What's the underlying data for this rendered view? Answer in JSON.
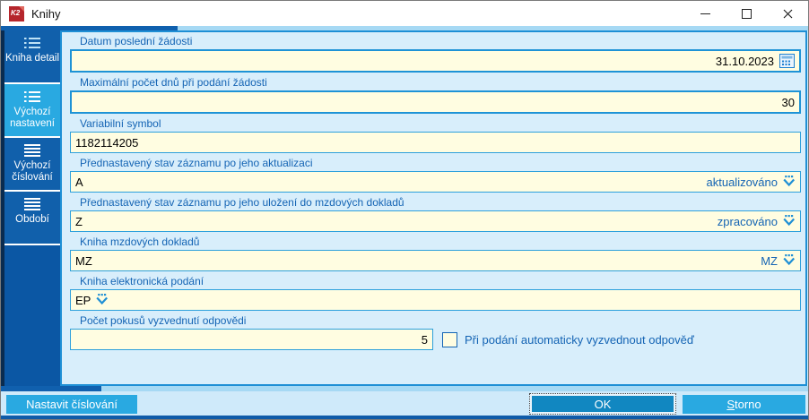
{
  "window": {
    "title": "Knihy"
  },
  "sidebar": {
    "items": [
      {
        "label": "Kniha detail",
        "active": false
      },
      {
        "label": "Výchozí nastavení",
        "active": true
      },
      {
        "label": "Výchozí číslování",
        "active": false
      },
      {
        "label": "Období",
        "active": false
      }
    ]
  },
  "form": {
    "fields": [
      {
        "label": "Datum poslední žádosti",
        "value": "31.10.2023"
      },
      {
        "label": "Maximální počet dnů při podání žádosti",
        "value": "30"
      },
      {
        "label": "Variabilní symbol",
        "value": "1182114205"
      },
      {
        "label": "Přednastavený stav záznamu po jeho aktualizaci",
        "value": "A",
        "display": "aktualizováno"
      },
      {
        "label": "Přednastavený stav záznamu po jeho uložení do mzdových dokladů",
        "value": "Z",
        "display": "zpracováno"
      },
      {
        "label": "Kniha mzdových dokladů",
        "value": "MZ",
        "display": "MZ"
      },
      {
        "label": "Kniha elektronická podání",
        "value": "EP",
        "display": ""
      },
      {
        "label": "Počet pokusů vyzvednutí odpovědi",
        "value": "5"
      }
    ],
    "checkbox": {
      "label": "Při podání automaticky vyzvednout odpověď",
      "checked": false
    }
  },
  "footer": {
    "buttons": [
      {
        "label": "Nastavit číslování"
      },
      {
        "label": "OK"
      },
      {
        "label": "Storno"
      }
    ]
  },
  "colors": {
    "accent": "#29a9e1",
    "sidebar": "#0b57a4",
    "field_bg": "#fffde1",
    "field_border": "#2da0dc",
    "label_text": "#1464b4",
    "ok_button": "#1187c1"
  }
}
